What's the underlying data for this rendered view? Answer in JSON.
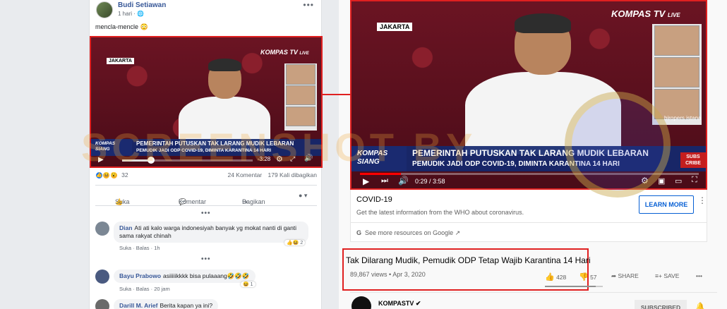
{
  "facebook": {
    "author": "Budi Setiawan",
    "time": "1 hari",
    "more": "•••",
    "caption": "mencla-mencle 😳",
    "video": {
      "location": "JAKARTA",
      "channel_logo": "KOMPAS TV",
      "live": "LIVE",
      "show_badge": "KOMPAS SIANG",
      "headline": "PEMERINTAH PUTUSKAN TAK LARANG MUDIK LEBARAN",
      "subheadline": "PEMUDIK JADI ODP COVID-19, DIMINTA KARANTINA 14 HARI",
      "remaining": "-3:28",
      "progress": 0.22
    },
    "reaction_count": "32",
    "comments_count": "24 Komentar",
    "shares_count": "179 Kali dibagikan",
    "actions": {
      "like": "Suka",
      "comment": "Komentar",
      "share": "Bagikan"
    },
    "dots": "•••",
    "comments": [
      {
        "name": "Dian",
        "text": "Ati ati kalo warga indonesiyah banyak yg mokat nanti di ganti",
        "text2": "sama rakyat chinah",
        "like": "Suka",
        "reply": "Balas",
        "time": "1h",
        "reactions": "2"
      },
      {
        "name": "Bayu Prabowo",
        "text": "asiiiiikkkk bisa pulaaang🤣🤣🤣",
        "like": "Suka",
        "reply": "Balas",
        "time": "20 jam",
        "reactions": "1"
      },
      {
        "name": "Darill M. Arief",
        "text": "Berita kapan ya ini?"
      }
    ]
  },
  "youtube": {
    "video": {
      "location": "JAKARTA",
      "channel_logo": "KOMPAS TV",
      "live": "LIVE",
      "show_badge": "KOMPAS SIANG",
      "headline": "PEMERINTAH PUTUSKAN TAK LARANG MUDIK LEBARAN",
      "subheadline": "PEMUDIK JADI ODP COVID-19, DIMINTA KARANTINA 14 HARI",
      "panel_credit": "biropers istana",
      "subscribe": "SUBS CRIBE",
      "time": "0:29 / 3:58",
      "progress": 0.12
    },
    "info_card": {
      "title": "COVID-19",
      "subtitle": "Get the latest information from the WHO about coronavirus.",
      "button": "LEARN MORE",
      "link": "See more resources on Google"
    },
    "title": "Tak Dilarang Mudik, Pemudik ODP Tetap Wajib Karantina 14 Hari",
    "views": "89,867 views • Apr 3, 2020",
    "likes": "428",
    "dislikes": "57",
    "share": "SHARE",
    "save": "SAVE",
    "more": "•••",
    "channel": "KOMPASTV",
    "subscribed": "SUBSCRIBED"
  },
  "watermark": "SCREENSHOT BY",
  "colors": {
    "highlight": "#e02020",
    "fb_link": "#385898",
    "yt_blue": "#065fd4",
    "news_bar": "#14286e"
  }
}
